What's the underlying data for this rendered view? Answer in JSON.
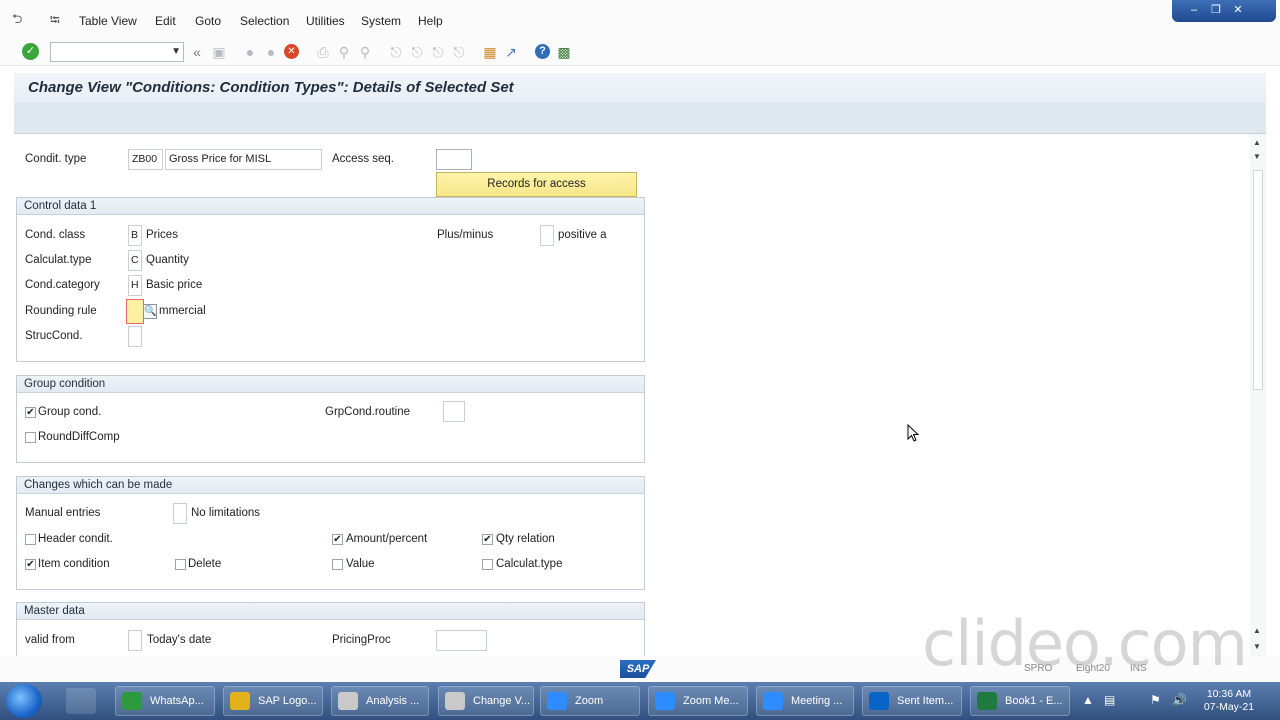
{
  "menu": {
    "items": [
      "Table View",
      "Edit",
      "Goto",
      "Selection",
      "Utilities",
      "System",
      "Help"
    ]
  },
  "window_controls": {
    "minimize": "–",
    "restore": "❐",
    "close": "✕"
  },
  "toolbar": {
    "command_field": "",
    "back_label": "«"
  },
  "page_title": "Change View \"Conditions: Condition Types\": Details of Selected Set",
  "header_fields": {
    "condit_type_label": "Condit. type",
    "condit_type_value": "ZB00",
    "condit_type_desc": "Gross Price for MISL",
    "access_seq_label": "Access seq.",
    "access_seq_value": "",
    "records_button": "Records for access"
  },
  "control_data_1": {
    "title": "Control data 1",
    "cond_class_label": "Cond. class",
    "cond_class_value": "B",
    "cond_class_desc": "Prices",
    "plus_minus_label": "Plus/minus",
    "plus_minus_value": "",
    "plus_minus_desc": "positive a",
    "calculat_type_label": "Calculat.type",
    "calculat_type_value": "C",
    "calculat_type_desc": "Quantity",
    "cond_category_label": "Cond.category",
    "cond_category_value": "H",
    "cond_category_desc": "Basic price",
    "rounding_rule_label": "Rounding rule",
    "rounding_rule_value": "",
    "rounding_rule_desc": "mmercial",
    "struc_cond_label": "StrucCond.",
    "struc_cond_value": ""
  },
  "group_condition": {
    "title": "Group condition",
    "group_cond_label": "Group cond.",
    "group_cond_checked": true,
    "round_diff_label": "RoundDiffComp",
    "round_diff_checked": false,
    "grp_routine_label": "GrpCond.routine",
    "grp_routine_value": ""
  },
  "changes": {
    "title": "Changes which can be made",
    "manual_entries_label": "Manual entries",
    "manual_entries_value": "",
    "manual_entries_desc": "No limitations",
    "header_condit_label": "Header condit.",
    "header_condit_checked": false,
    "amount_percent_label": "Amount/percent",
    "amount_percent_checked": true,
    "qty_relation_label": "Qty relation",
    "qty_relation_checked": true,
    "item_condition_label": "Item condition",
    "item_condition_checked": true,
    "delete_label": "Delete",
    "delete_checked": false,
    "value_label": "Value",
    "value_checked": false,
    "calculat_type_label": "Calculat.type",
    "calculat_type_checked": false
  },
  "master_data": {
    "title": "Master data",
    "valid_from_label": "valid from",
    "valid_from_value": "",
    "valid_from_desc": "Today's date",
    "pricing_proc_label": "PricingProc",
    "pricing_proc_value": ""
  },
  "status": {
    "sap_logo": "SAP",
    "watermark": "clideo.com",
    "system_fragment": "SPRO",
    "session_fragment": "Eight20",
    "mode_fragment": "INS"
  },
  "taskbar": {
    "buttons": [
      {
        "label": "WhatsAp...",
        "color": "#2e9a3e"
      },
      {
        "label": "SAP Logo...",
        "color": "#e3b21b"
      },
      {
        "label": "Analysis ...",
        "color": "#c9c9c9"
      },
      {
        "label": "Change V...",
        "color": "#c9c9c9"
      },
      {
        "label": "Zoom",
        "color": "#2d8cff"
      },
      {
        "label": "Zoom Me...",
        "color": "#2d8cff"
      },
      {
        "label": "Meeting ...",
        "color": "#2d8cff"
      },
      {
        "label": "Sent Item...",
        "color": "#0a64c8"
      },
      {
        "label": "Book1 - E...",
        "color": "#1f7a3f"
      }
    ],
    "time": "10:36 AM",
    "date": "07-May-21"
  }
}
